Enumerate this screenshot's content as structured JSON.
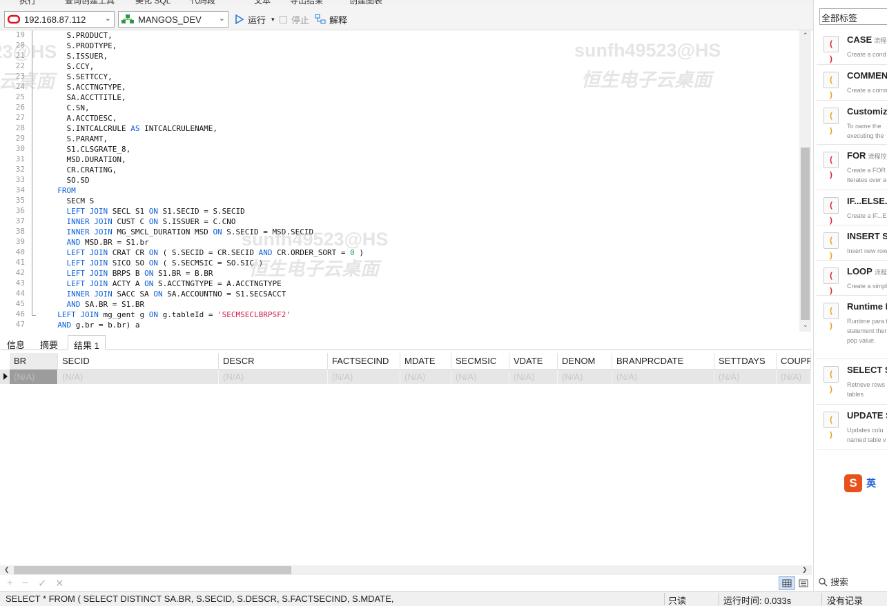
{
  "top_menu": [
    "执行",
    "查询创建工具",
    "美化 SQL",
    "代码段",
    "文本",
    "导出结果",
    "创建图表"
  ],
  "toolbar": {
    "connection": "192.168.87.112",
    "database": "MANGOS_DEV",
    "run_label": "运行",
    "stop_label": "停止",
    "explain_label": "解释"
  },
  "editor": {
    "lines": [
      {
        "n": "19",
        "parts": [
          [
            "",
            "    S.PRODUCT,"
          ]
        ]
      },
      {
        "n": "20",
        "parts": [
          [
            "",
            "    S.PRODTYPE,"
          ]
        ]
      },
      {
        "n": "21",
        "parts": [
          [
            "",
            "    S.ISSUER,"
          ]
        ]
      },
      {
        "n": "22",
        "parts": [
          [
            "",
            "    S.CCY,"
          ]
        ]
      },
      {
        "n": "23",
        "parts": [
          [
            "",
            "    S.SETTCCY,"
          ]
        ]
      },
      {
        "n": "24",
        "parts": [
          [
            "",
            "    S.ACCTNGTYPE,"
          ]
        ]
      },
      {
        "n": "25",
        "parts": [
          [
            "",
            "    SA.ACCTTITLE,"
          ]
        ]
      },
      {
        "n": "26",
        "parts": [
          [
            "",
            "    C.SN,"
          ]
        ]
      },
      {
        "n": "27",
        "parts": [
          [
            "",
            "    A.ACCTDESC,"
          ]
        ]
      },
      {
        "n": "28",
        "parts": [
          [
            "",
            "    S.INTCALCRULE "
          ],
          [
            "kw",
            "AS"
          ],
          [
            "",
            " INTCALCRULENAME,"
          ]
        ]
      },
      {
        "n": "29",
        "parts": [
          [
            "",
            "    S.PARAMT,"
          ]
        ]
      },
      {
        "n": "30",
        "parts": [
          [
            "",
            "    S1.CLSGRATE_8,"
          ]
        ]
      },
      {
        "n": "31",
        "parts": [
          [
            "",
            "    MSD.DURATION,"
          ]
        ]
      },
      {
        "n": "32",
        "parts": [
          [
            "",
            "    CR.CRATING,"
          ]
        ]
      },
      {
        "n": "33",
        "parts": [
          [
            "",
            "    SO.SD"
          ]
        ]
      },
      {
        "n": "34",
        "parts": [
          [
            "",
            "  "
          ],
          [
            "kw",
            "FROM"
          ]
        ]
      },
      {
        "n": "35",
        "parts": [
          [
            "",
            "    SECM S"
          ]
        ]
      },
      {
        "n": "36",
        "parts": [
          [
            "",
            "    "
          ],
          [
            "kw",
            "LEFT JOIN"
          ],
          [
            "",
            " SECL S1 "
          ],
          [
            "kw",
            "ON"
          ],
          [
            "",
            " S1.SECID = S.SECID"
          ]
        ]
      },
      {
        "n": "37",
        "parts": [
          [
            "",
            "    "
          ],
          [
            "kw",
            "INNER JOIN"
          ],
          [
            "",
            " CUST C "
          ],
          [
            "kw",
            "ON"
          ],
          [
            "",
            " S.ISSUER = C.CNO"
          ]
        ]
      },
      {
        "n": "38",
        "parts": [
          [
            "",
            "    "
          ],
          [
            "kw",
            "INNER JOIN"
          ],
          [
            "",
            " MG_SMCL_DURATION MSD "
          ],
          [
            "kw",
            "ON"
          ],
          [
            "",
            " S.SECID = MSD.SECID"
          ]
        ]
      },
      {
        "n": "39",
        "parts": [
          [
            "",
            "    "
          ],
          [
            "kw",
            "AND"
          ],
          [
            "",
            " MSD.BR = S1.br"
          ]
        ]
      },
      {
        "n": "40",
        "parts": [
          [
            "",
            "    "
          ],
          [
            "kw",
            "LEFT JOIN"
          ],
          [
            "",
            " CRAT CR "
          ],
          [
            "kw",
            "ON"
          ],
          [
            "",
            " ( S.SECID = CR.SECID "
          ],
          [
            "kw",
            "AND"
          ],
          [
            "",
            " CR.ORDER_SORT = "
          ],
          [
            "num",
            "0"
          ],
          [
            "",
            " )"
          ]
        ]
      },
      {
        "n": "41",
        "parts": [
          [
            "",
            "    "
          ],
          [
            "kw",
            "LEFT JOIN"
          ],
          [
            "",
            " SICO SO "
          ],
          [
            "kw",
            "ON"
          ],
          [
            "",
            " ( S.SECMSIC = SO.SIC )"
          ]
        ]
      },
      {
        "n": "42",
        "parts": [
          [
            "",
            "    "
          ],
          [
            "kw",
            "LEFT JOIN"
          ],
          [
            "",
            " BRPS B "
          ],
          [
            "kw",
            "ON"
          ],
          [
            "",
            " S1.BR = B.BR"
          ]
        ]
      },
      {
        "n": "43",
        "parts": [
          [
            "",
            "    "
          ],
          [
            "kw",
            "LEFT JOIN"
          ],
          [
            "",
            " ACTY A "
          ],
          [
            "kw",
            "ON"
          ],
          [
            "",
            " S.ACCTNGTYPE = A.ACCTNGTYPE"
          ]
        ]
      },
      {
        "n": "44",
        "parts": [
          [
            "",
            "    "
          ],
          [
            "kw",
            "INNER JOIN"
          ],
          [
            "",
            " SACC SA "
          ],
          [
            "kw",
            "ON"
          ],
          [
            "",
            " SA.ACCOUNTNO = S1.SECSACCT"
          ]
        ]
      },
      {
        "n": "45",
        "parts": [
          [
            "",
            "    "
          ],
          [
            "kw",
            "AND"
          ],
          [
            "",
            " SA.BR = S1.BR"
          ]
        ]
      },
      {
        "n": "46",
        "parts": [
          [
            "",
            "  "
          ],
          [
            "kw",
            "LEFT JOIN"
          ],
          [
            "",
            " mg_gent g "
          ],
          [
            "kw",
            "ON"
          ],
          [
            "",
            " g.tableId = "
          ],
          [
            "str",
            "'SECMSECLBRPSF2'"
          ]
        ]
      },
      {
        "n": "47",
        "parts": [
          [
            "",
            "  "
          ],
          [
            "kw",
            "AND"
          ],
          [
            "",
            " g.br = b.br) a"
          ]
        ]
      }
    ]
  },
  "watermark": {
    "account": "sunfh49523@HS",
    "brand": "恒生电子云桌面"
  },
  "result_tabs": [
    "信息",
    "摘要",
    "结果 1"
  ],
  "grid": {
    "columns": [
      "BR",
      "SECID",
      "DESCR",
      "FACTSECIND",
      "MDATE",
      "SECMSIC",
      "VDATE",
      "DENOM",
      "BRANPRCDATE",
      "SETTDAYS",
      "COUPR"
    ],
    "row": [
      "(N/A)",
      "(N/A)",
      "(N/A)",
      "(N/A)",
      "(N/A)",
      "(N/A)",
      "(N/A)",
      "(N/A)",
      "(N/A)",
      "(N/A)",
      "(N/A)"
    ]
  },
  "status": {
    "sql": "SELECT    *  FROM  (         SELECT DISTINCT              SA.BR,                      S.SECID,                    S.DESCR,                           S.FACTSECIND,                       S.MDATE,",
    "readonly": "只读",
    "elapsed": "运行时间: 0.033s",
    "records": "没有记录"
  },
  "right_panel": {
    "tag_filter": "全部标签",
    "snippets": [
      {
        "title": "CASE",
        "tag": "流程控",
        "desc": "Create a cond",
        "color": "#d9263b"
      },
      {
        "title": "COMMEN",
        "tag": "",
        "desc": "Create a comm",
        "color": "#e6a21a"
      },
      {
        "title": "Customiz",
        "tag": "",
        "desc": "To name the executing the",
        "color": "#e6a21a"
      },
      {
        "title": "FOR",
        "tag": "流程控",
        "desc": "Create a FOR iterates over a",
        "color": "#d9263b"
      },
      {
        "title": "IF...ELSE...",
        "tag": "",
        "desc": "Create a IF...EL",
        "color": "#d9263b"
      },
      {
        "title": "INSERT Sy",
        "tag": "",
        "desc": "Insert new row",
        "color": "#e6a21a"
      },
      {
        "title": "LOOP",
        "tag": "流程控",
        "desc": "Create a simpl",
        "color": "#d9263b"
      },
      {
        "title": "Runtime I",
        "tag": "",
        "desc": "Runtime para the statement then will pop value.",
        "color": "#e6a21a"
      },
      {
        "title": "SELECT Sy",
        "tag": "",
        "desc": "Retrieve rows tables",
        "color": "#e6a21a"
      },
      {
        "title": "UPDATE S",
        "tag": "",
        "desc": "Updates colu named table v",
        "color": "#e6a21a"
      }
    ],
    "ime_label": "英",
    "search_label": "搜索"
  }
}
